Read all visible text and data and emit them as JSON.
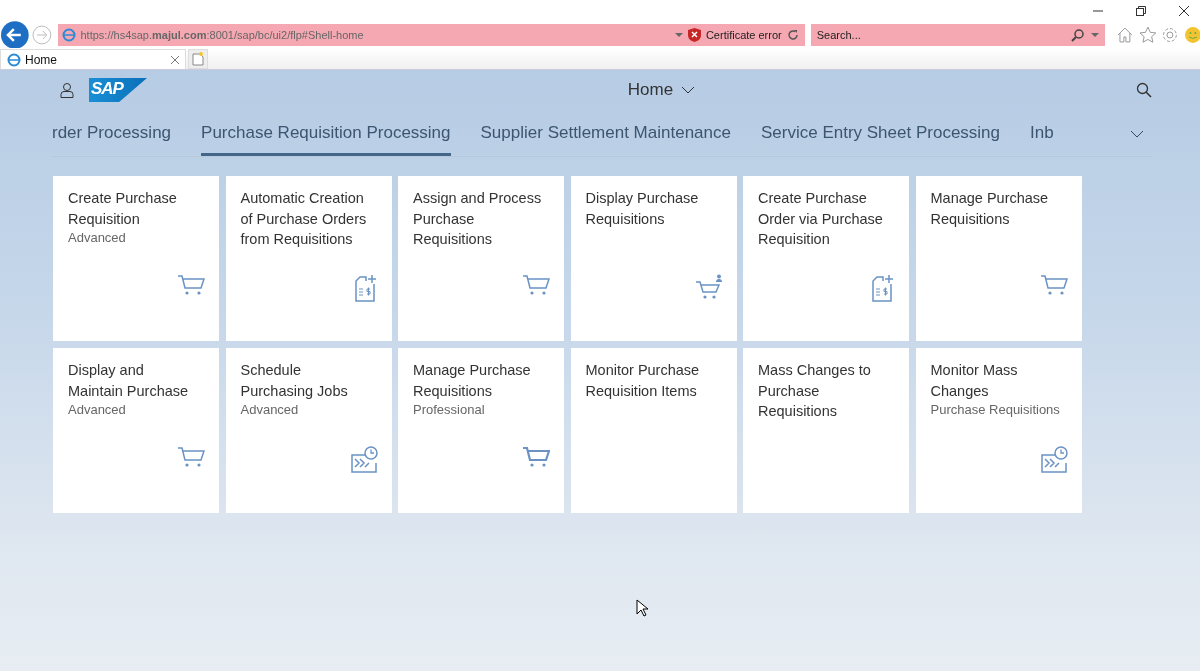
{
  "browser": {
    "address": "https://hs4sap.**majul.com**:8001/sap/bc/ui2/flp#Shell-home",
    "certificate": "Certificate error",
    "search": {
      "placeholder": "Search..."
    },
    "tab": {
      "title": "Home"
    }
  },
  "shell": {
    "logo": "SAP",
    "title": "Home"
  },
  "groups": [
    {
      "label": "rder Processing",
      "selected": false
    },
    {
      "label": "Purchase Requisition Processing",
      "selected": true
    },
    {
      "label": "Supplier Settlement Maintenance",
      "selected": false
    },
    {
      "label": "Service Entry Sheet Processing",
      "selected": false
    },
    {
      "label": "Inb",
      "selected": false
    }
  ],
  "tiles": [
    {
      "title": "Create Purchase Requisition",
      "subtitle": "Advanced",
      "kind": "cart"
    },
    {
      "title": "Automatic Creation of Purchase Orders from Requisitions",
      "kind": "document"
    },
    {
      "title": "Assign and Process Purchase Requisitions",
      "kind": "cart"
    },
    {
      "title": "Display Purchase Requisitions",
      "kind": "cart-person"
    },
    {
      "title": "Create Purchase Order via Purchase Requisition",
      "kind": "document"
    },
    {
      "title": "Manage Purchase Requisitions",
      "kind": "cart"
    },
    {
      "title": "Display and Maintain Purchase",
      "subtitle": "Advanced",
      "kind": "cart"
    },
    {
      "title": "Schedule Purchasing Jobs",
      "subtitle": "Advanced",
      "kind": "schedule"
    },
    {
      "title": "Manage Purchase Requisitions",
      "subtitle": "Professional",
      "kind": "cart-solid"
    },
    {
      "title": "Monitor Purchase Requisition Items"
    },
    {
      "title": "Mass Changes to Purchase Requisitions"
    },
    {
      "title": "Monitor Mass Changes",
      "subtitle": "Purchase Requisitions",
      "kind": "schedule"
    }
  ]
}
